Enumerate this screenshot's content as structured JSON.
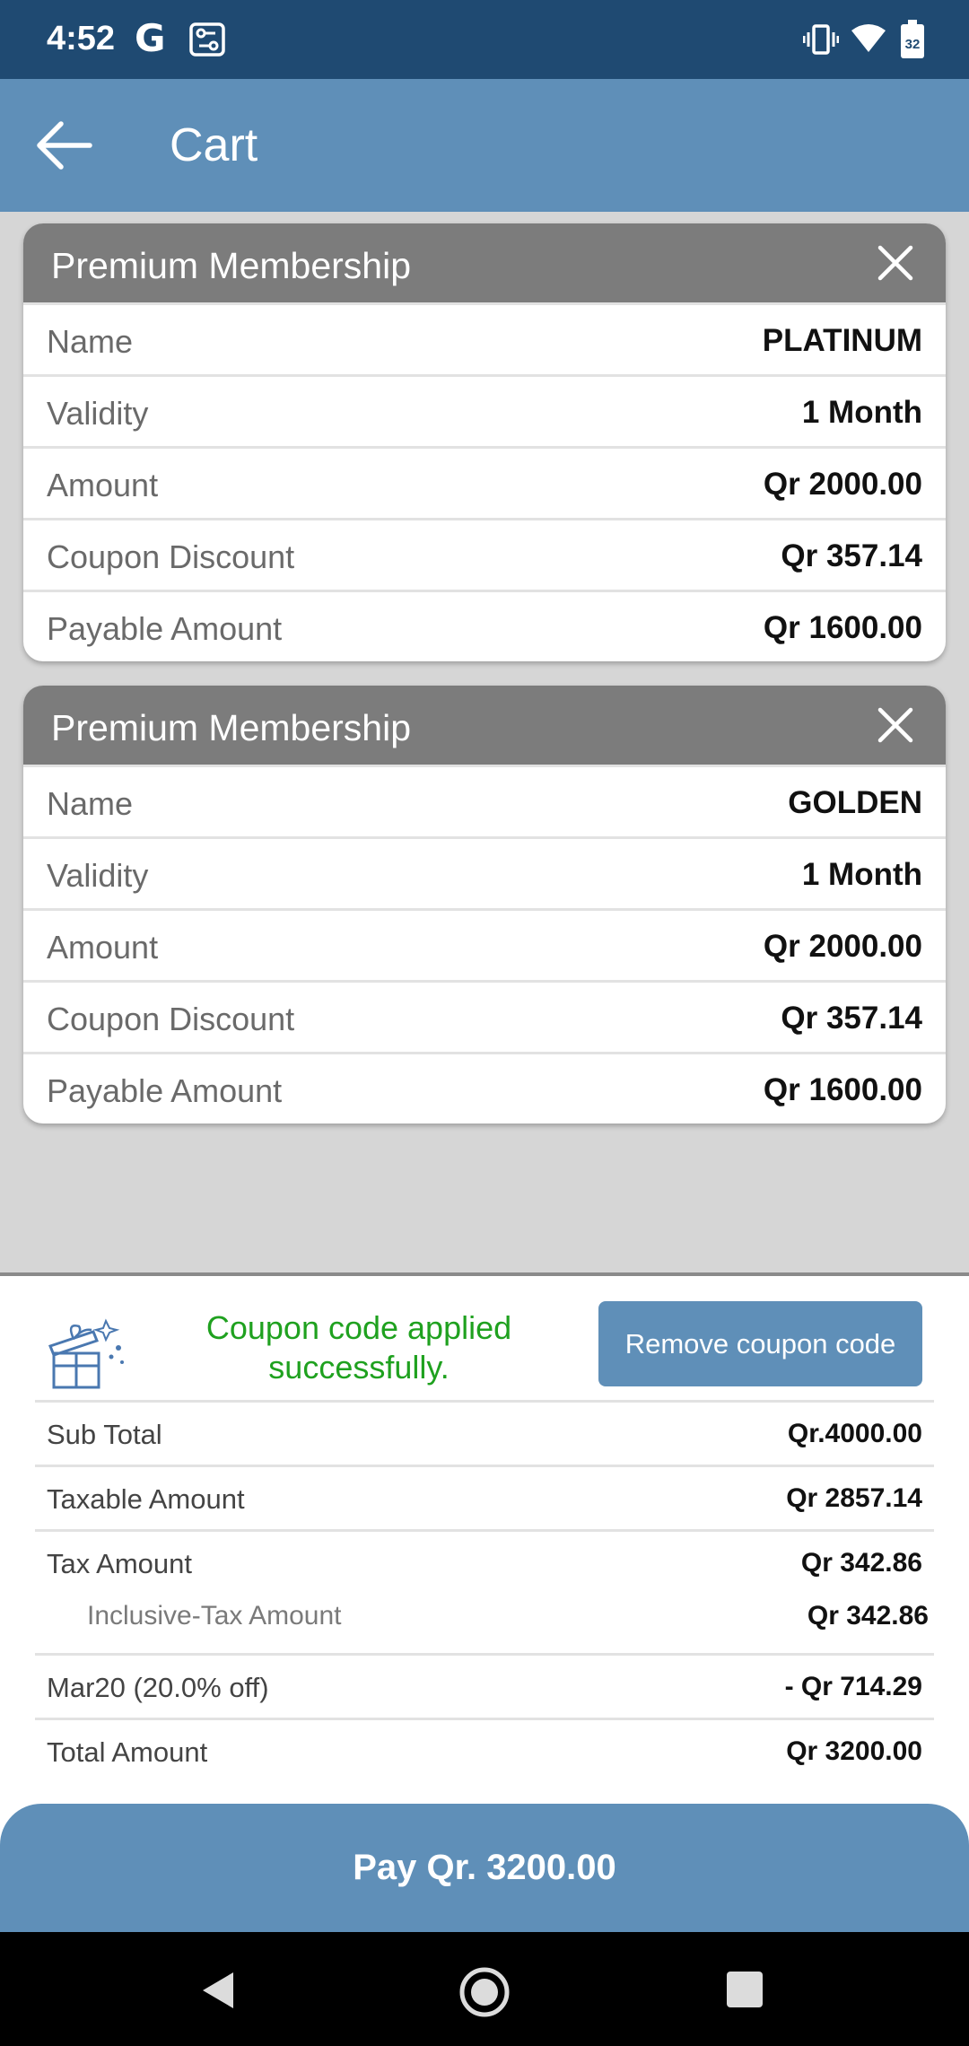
{
  "status_bar": {
    "time": "4:52",
    "g_glyph": "G",
    "battery_level": "32"
  },
  "app_bar": {
    "title": "Cart"
  },
  "cards": [
    {
      "title": "Premium Membership",
      "rows": [
        {
          "label": "Name",
          "value": "PLATINUM"
        },
        {
          "label": "Validity",
          "value": "1 Month"
        },
        {
          "label": "Amount",
          "value": "Qr 2000.00"
        },
        {
          "label": "Coupon Discount",
          "value": "Qr 357.14"
        },
        {
          "label": "Payable Amount",
          "value": "Qr 1600.00"
        }
      ]
    },
    {
      "title": "Premium Membership",
      "rows": [
        {
          "label": "Name",
          "value": "GOLDEN"
        },
        {
          "label": "Validity",
          "value": "1 Month"
        },
        {
          "label": "Amount",
          "value": "Qr 2000.00"
        },
        {
          "label": "Coupon Discount",
          "value": "Qr 357.14"
        },
        {
          "label": "Payable Amount",
          "value": "Qr 1600.00"
        }
      ]
    }
  ],
  "coupon": {
    "message_line1": "Coupon code applied",
    "message_line2": "successfully.",
    "remove_label": "Remove coupon code"
  },
  "summary": {
    "sub_total": {
      "label": "Sub Total",
      "value": "Qr.4000.00"
    },
    "taxable": {
      "label": "Taxable Amount",
      "value": "Qr 2857.14"
    },
    "tax": {
      "label": "Tax Amount",
      "value": "Qr 342.86"
    },
    "inclusive_tax": {
      "label": "Inclusive-Tax Amount",
      "value": "Qr 342.86"
    },
    "coupon_line": {
      "label": "Mar20 (20.0% off)",
      "value": "- Qr 714.29"
    },
    "total": {
      "label": "Total Amount",
      "value": "Qr 3200.00"
    }
  },
  "pay_button": {
    "label": "Pay Qr. 3200.00"
  },
  "colors": {
    "status_bar": "#1f4a72",
    "app_bar": "#5f8fb8",
    "card_header": "#7c7c7c",
    "success": "#1fa11f"
  }
}
